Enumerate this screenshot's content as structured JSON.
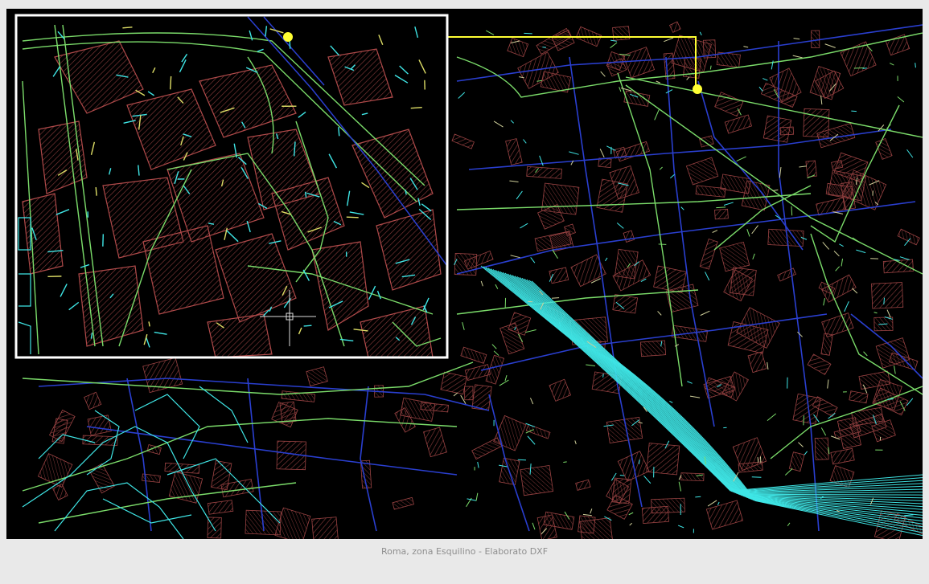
{
  "caption": "Roma, zona Esquilino - Elaborato DXF",
  "colors": {
    "page_background": "#e9e9e9",
    "map_background": "#000000",
    "buildings": "#b04a4a",
    "building_hatch": "#7a3535",
    "streets_green": "#7bdc6a",
    "streets_blue": "#2440c8",
    "railway_cyan": "#3fe6e6",
    "highlight_yellow": "#ffff33",
    "inset_frame": "#ffffff",
    "caption_text": "#8f8f8f"
  },
  "zoom_inset": {
    "description": "magnified detail view",
    "cursor_crosshair": true
  },
  "markers": [
    "start-marker",
    "end-marker"
  ]
}
